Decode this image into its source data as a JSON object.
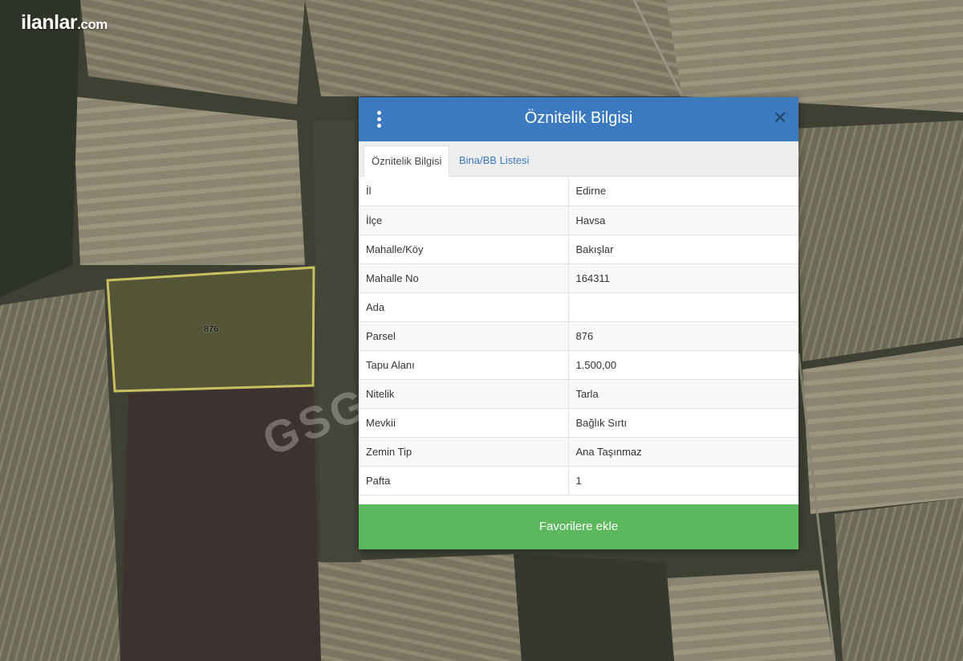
{
  "site": {
    "logo_main": "ilanlar",
    "logo_suffix": ".com"
  },
  "map": {
    "parcel_label": "876",
    "watermark": "GSG E",
    "parcel_outline_color": "#c8c060"
  },
  "dialog": {
    "title": "Öznitelik Bilgisi",
    "menu_icon": "more-vertical-icon",
    "close_icon": "close-icon",
    "close_glyph": "✕",
    "header_color": "#3c7ac0",
    "tabs": [
      {
        "label": "Öznitelik Bilgisi",
        "active": true
      },
      {
        "label": "Bina/BB Listesi",
        "active": false
      }
    ],
    "rows": [
      {
        "key": "İl",
        "value": "Edirne"
      },
      {
        "key": "İlçe",
        "value": "Havsa"
      },
      {
        "key": "Mahalle/Köy",
        "value": "Bakışlar"
      },
      {
        "key": "Mahalle No",
        "value": "164311"
      },
      {
        "key": "Ada",
        "value": ""
      },
      {
        "key": "Parsel",
        "value": "876"
      },
      {
        "key": "Tapu Alanı",
        "value": "1.500,00"
      },
      {
        "key": "Nitelik",
        "value": "Tarla"
      },
      {
        "key": "Mevkii",
        "value": "Bağlık Sırtı"
      },
      {
        "key": "Zemin Tip",
        "value": "Ana Taşınmaz"
      },
      {
        "key": "Pafta",
        "value": "1"
      }
    ],
    "favorite_button": "Favorilere ekle",
    "favorite_color": "#5cb85c"
  }
}
